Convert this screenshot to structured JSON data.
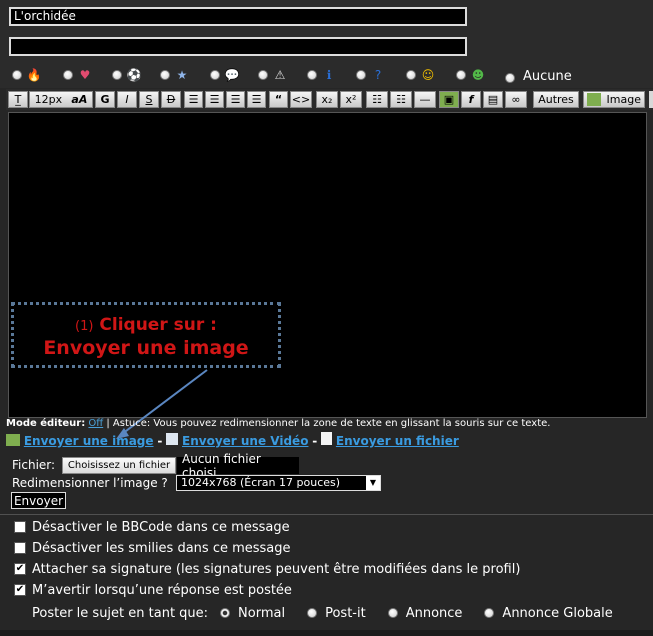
{
  "title_input": {
    "value": "L'orchidée"
  },
  "description_input": {
    "value": ""
  },
  "icons": {
    "items": [
      {
        "name": "fire-icon",
        "glyph": "🔥",
        "color": "#e0643a",
        "selected": false
      },
      {
        "name": "heart-icon",
        "glyph": "♥",
        "color": "#e14b6f",
        "selected": false
      },
      {
        "name": "soccer-ball-icon",
        "glyph": "⚽",
        "color": "#ffffff",
        "selected": false
      },
      {
        "name": "star-icon",
        "glyph": "★",
        "color": "#8fb4e8",
        "selected": false
      },
      {
        "name": "speech-bubble-icon",
        "glyph": "💬",
        "color": "#8fb4e8",
        "selected": false
      },
      {
        "name": "warning-icon",
        "glyph": "⚠",
        "color": "#dddddd",
        "selected": false
      },
      {
        "name": "info-icon",
        "glyph": "ℹ",
        "color": "#2a6fd6",
        "selected": false
      },
      {
        "name": "question-icon",
        "glyph": "?",
        "color": "#2a6fd6",
        "selected": false
      },
      {
        "name": "smiley-icon",
        "glyph": "☺",
        "color": "#f2c000",
        "selected": false
      },
      {
        "name": "grin-icon",
        "glyph": "☻",
        "color": "#52b848",
        "selected": false
      }
    ],
    "none_label": "Aucune",
    "none_selected": true
  },
  "toolbar": {
    "font_size": "12px",
    "font_label": "aA",
    "bold": "G",
    "italic": "I",
    "strike": "S",
    "underline": "D",
    "quote": "“",
    "code": "<>",
    "sub": "x₂",
    "sup": "x²",
    "others": "Autres",
    "image": "Image"
  },
  "callout": {
    "line1_num": "(1)",
    "line1": "Cliquer sur :",
    "line2": "Envoyer une image"
  },
  "mode": {
    "label": "Mode éditeur:",
    "off": "Off",
    "tip": "| Astuce: Vous pouvez redimensionner la zone de texte en glissant la souris sur ce texte."
  },
  "upload_links": {
    "image": "Envoyer une image",
    "video": "Envoyer une Vidéo",
    "file": "Envoyer un fichier",
    "sep": "-"
  },
  "upload": {
    "file_label": "Fichier:",
    "choose": "Choisissez un fichier",
    "no_file": "Aucun fichier choisi",
    "resize_label": "Redimensionner l’image ?",
    "resize_value": "1024x768 (Écran 17 pouces)",
    "send": "Envoyer"
  },
  "options": [
    {
      "label": "Désactiver le BBCode dans ce message",
      "checked": false
    },
    {
      "label": "Désactiver les smilies dans ce message",
      "checked": false
    },
    {
      "label": "Attacher sa signature (les signatures peuvent être modifiées dans le profil)",
      "checked": true
    },
    {
      "label": "M’avertir lorsqu’une réponse est postée",
      "checked": true
    }
  ],
  "post_as": {
    "label": "Poster le sujet en tant que:",
    "normal": "Normal",
    "postit": "Post-it",
    "annonce": "Annonce",
    "globale": "Annonce Globale"
  },
  "colors": {
    "link": "#3a9be0",
    "callout_text": "#d01616",
    "callout_border": "#5a7898",
    "arrow": "#5a86c0"
  }
}
